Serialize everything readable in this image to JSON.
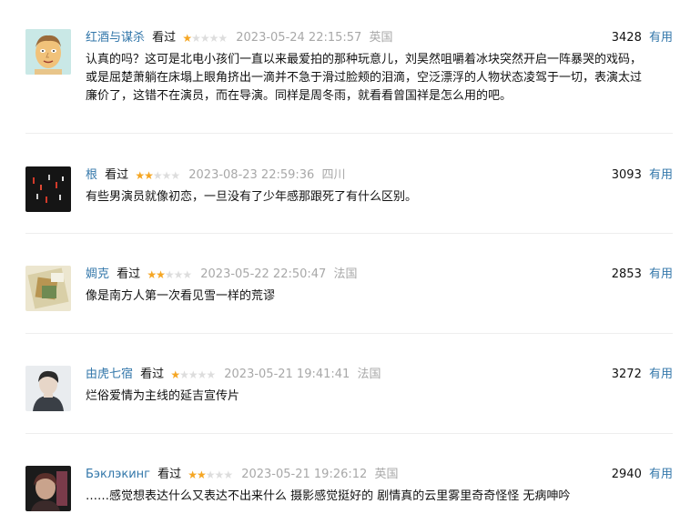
{
  "comments": [
    {
      "user": "红酒与谋杀",
      "status": "看过",
      "rating": 1,
      "time": "2023-05-24 22:15:57",
      "location": "英国",
      "votes": "3428",
      "useful_label": "有用",
      "text_lines": [
        "认真的吗？这可是北电小孩们一直以来最爱拍的那种玩意儿，刘昊然咀嚼着冰块突然开启一阵暴哭的戏码，",
        "或是屈楚萧躺在床塌上眼角挤出一滴并不急于滑过脸颊的泪滴，空泛漂浮的人物状态凌驾于一切，表演太过",
        "廉价了，这错不在演员，而在导演。同样是周冬雨，就看看曾国祥是怎么用的吧。"
      ]
    },
    {
      "user": "根",
      "status": "看过",
      "rating": 2,
      "time": "2023-08-23 22:59:36",
      "location": "四川",
      "votes": "3093",
      "useful_label": "有用",
      "text_lines": [
        "有些男演员就像初恋，一旦没有了少年感那跟死了有什么区别。"
      ]
    },
    {
      "user": "婤克",
      "status": "看过",
      "rating": 2,
      "time": "2023-05-22 22:50:47",
      "location": "法国",
      "votes": "2853",
      "useful_label": "有用",
      "text_lines": [
        "像是南方人第一次看见雪一样的荒谬"
      ]
    },
    {
      "user": "由虎七宿",
      "status": "看过",
      "rating": 1,
      "time": "2023-05-21 19:41:41",
      "location": "法国",
      "votes": "3272",
      "useful_label": "有用",
      "text_lines": [
        "烂俗爱情为主线的延吉宣传片"
      ]
    },
    {
      "user": "Бэклэкинг",
      "status": "看过",
      "rating": 2,
      "time": "2023-05-21 19:26:12",
      "location": "英国",
      "votes": "2940",
      "useful_label": "有用",
      "text_lines": [
        "……感觉想表达什么又表达不出来什么 摄影感觉挺好的 剧情真的云里雾里奇奇怪怪 无病呻吟"
      ]
    }
  ],
  "colors": {
    "link": "#3377aa",
    "star_on": "#f5a623",
    "star_off": "#dddddd",
    "meta_gray": "#a8a8a8",
    "divider": "#eeeeee"
  }
}
